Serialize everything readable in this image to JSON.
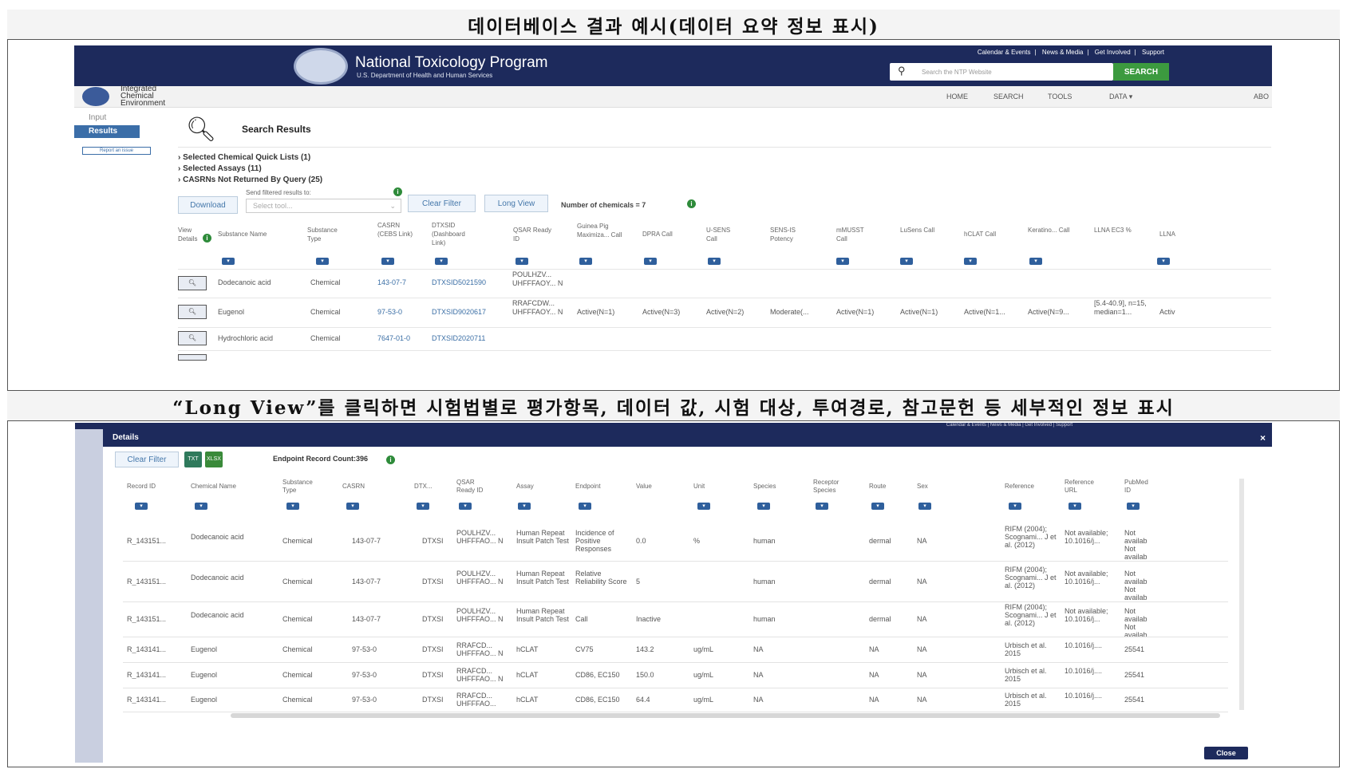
{
  "captions": {
    "top": "데이터베이스 결과 예시(데이터 요약 정보 표시)",
    "bottom": "“Long View”를 클릭하면 시험법별로 평가항목, 데이터 값, 시험 대상, 투여경로, 참고문헌 등 세부적인 정보 표시"
  },
  "ntp": {
    "title": "National Toxicology Program",
    "subtitle": "U.S. Department of Health and Human Services",
    "top_links": [
      "Calendar & Events",
      "News & Media",
      "Get Involved",
      "Support"
    ],
    "search_placeholder": "Search the NTP Website",
    "search_button": "SEARCH"
  },
  "ice": {
    "logo_text": "Integrated Chemical Environment",
    "nav": [
      "HOME",
      "SEARCH",
      "TOOLS",
      "DATA",
      "ABO"
    ]
  },
  "sidebar": {
    "input": "Input",
    "results": "Results",
    "report": "Report an issue"
  },
  "results": {
    "title": "Search Results",
    "quicklists": [
      "Selected Chemical Quick Lists (1)",
      "Selected Assays (11)",
      "CASRNs Not Returned By Query (25)"
    ],
    "send_label": "Send filtered results to:",
    "download": "Download",
    "select_tool": "Select tool...",
    "clear_filter": "Clear Filter",
    "long_view": "Long View",
    "num_chemicals": "Number of chemicals = 7",
    "columns": [
      "View Details",
      "Substance Name",
      "Substance Type",
      "CASRN (CEBS Link)",
      "DTXSID (Dashboard Link)",
      "QSAR Ready ID",
      "Guinea Pig Maximiza... Call",
      "DPRA Call",
      "U-SENS Call",
      "SENS-IS Potency",
      "mMUSST Call",
      "LuSens Call",
      "hCLAT Call",
      "Keratino... Call",
      "LLNA EC3 %",
      "LLNA"
    ],
    "rows": [
      {
        "name": "Dodecanoic acid",
        "type": "Chemical",
        "casrn": "143-07-7",
        "dtxsid": "DTXSID5021590",
        "qsar": "POULHZV... UHFFFAOY... N",
        "gpm": "",
        "dpra": "",
        "usens": "",
        "sensis": "",
        "mmusst": "",
        "lusens": "",
        "hclat": "",
        "kerat": "",
        "llna3": "",
        "llna": ""
      },
      {
        "name": "Eugenol",
        "type": "Chemical",
        "casrn": "97-53-0",
        "dtxsid": "DTXSID9020617",
        "qsar": "RRAFCDW... UHFFFAOY... N",
        "gpm": "Active(N=1)",
        "dpra": "Active(N=3)",
        "usens": "Active(N=2)",
        "sensis": "Moderate(...",
        "mmusst": "Active(N=1)",
        "lusens": "Active(N=1)",
        "hclat": "Active(N=1...",
        "kerat": "Active(N=9...",
        "llna3": "[5.4-40.9], n=15, median=1...",
        "llna": "Activ"
      },
      {
        "name": "Hydrochloric acid",
        "type": "Chemical",
        "casrn": "7647-01-0",
        "dtxsid": "DTXSID2020711",
        "qsar": "",
        "gpm": "",
        "dpra": "",
        "usens": "",
        "sensis": "",
        "mmusst": "",
        "lusens": "",
        "hclat": "",
        "kerat": "",
        "llna3": "",
        "llna": ""
      }
    ]
  },
  "details": {
    "title": "Details",
    "clear_filter": "Clear Filter",
    "txt": "TXT",
    "xlsx": "XLSX",
    "count": "Endpoint Record Count:396",
    "close": "Close",
    "columns": [
      "Record ID",
      "Chemical Name",
      "Substance Type",
      "CASRN",
      "DTX...",
      "QSAR Ready ID",
      "Assay",
      "Endpoint",
      "Value",
      "Unit",
      "Species",
      "Receptor Species",
      "Route",
      "Sex",
      "Reference",
      "Reference URL",
      "PubMed ID"
    ],
    "rows": [
      {
        "rid": "R_143151...",
        "chem": "Dodecanoic acid",
        "type": "Chemical",
        "casrn": "143-07-7",
        "dtx": "DTXSI",
        "qsar": "POULHZV... UHFFFAO... N",
        "assay": "Human Repeat Insult Patch Test",
        "endpoint": "Incidence of Positive Responses",
        "value": "0.0",
        "unit": "%",
        "species": "human",
        "rspecies": "",
        "route": "dermal",
        "sex": "NA",
        "ref": "RIFM (2004); Scognami... J et al. (2012)",
        "url": "Not available; 10.1016/j...",
        "pmid": "Not availab Not availab"
      },
      {
        "rid": "R_143151...",
        "chem": "Dodecanoic acid",
        "type": "Chemical",
        "casrn": "143-07-7",
        "dtx": "DTXSI",
        "qsar": "POULHZV... UHFFFAO... N",
        "assay": "Human Repeat Insult Patch Test",
        "endpoint": "Relative Reliability Score",
        "value": "5",
        "unit": "",
        "species": "human",
        "rspecies": "",
        "route": "dermal",
        "sex": "NA",
        "ref": "RIFM (2004); Scognami... J et al. (2012)",
        "url": "Not available; 10.1016/j...",
        "pmid": "Not availab Not availab"
      },
      {
        "rid": "R_143151...",
        "chem": "Dodecanoic acid",
        "type": "Chemical",
        "casrn": "143-07-7",
        "dtx": "DTXSI",
        "qsar": "POULHZV... UHFFFAO... N",
        "assay": "Human Repeat Insult Patch Test",
        "endpoint": "Call",
        "value": "Inactive",
        "unit": "",
        "species": "human",
        "rspecies": "",
        "route": "dermal",
        "sex": "NA",
        "ref": "RIFM (2004); Scognami... J et al. (2012)",
        "url": "Not available; 10.1016/j...",
        "pmid": "Not availab Not availab"
      },
      {
        "rid": "R_143141...",
        "chem": "Eugenol",
        "type": "Chemical",
        "casrn": "97-53-0",
        "dtx": "DTXSI",
        "qsar": "RRAFCD... UHFFFAO... N",
        "assay": "hCLAT",
        "endpoint": "CV75",
        "value": "143.2",
        "unit": "ug/mL",
        "species": "NA",
        "rspecies": "",
        "route": "NA",
        "sex": "NA",
        "ref": "Urbisch et al. 2015",
        "url": "10.1016/j....",
        "pmid": "25541"
      },
      {
        "rid": "R_143141...",
        "chem": "Eugenol",
        "type": "Chemical",
        "casrn": "97-53-0",
        "dtx": "DTXSI",
        "qsar": "RRAFCD... UHFFFAO... N",
        "assay": "hCLAT",
        "endpoint": "CD86, EC150",
        "value": "150.0",
        "unit": "ug/mL",
        "species": "NA",
        "rspecies": "",
        "route": "NA",
        "sex": "NA",
        "ref": "Urbisch et al. 2015",
        "url": "10.1016/j....",
        "pmid": "25541"
      },
      {
        "rid": "R_143141...",
        "chem": "Eugenol",
        "type": "Chemical",
        "casrn": "97-53-0",
        "dtx": "DTXSI",
        "qsar": "RRAFCD... UHFFFAO...",
        "assay": "hCLAT",
        "endpoint": "CD86, EC150",
        "value": "64.4",
        "unit": "ug/mL",
        "species": "NA",
        "rspecies": "",
        "route": "NA",
        "sex": "NA",
        "ref": "Urbisch et al. 2015",
        "url": "10.1016/j....",
        "pmid": "25541"
      }
    ]
  }
}
